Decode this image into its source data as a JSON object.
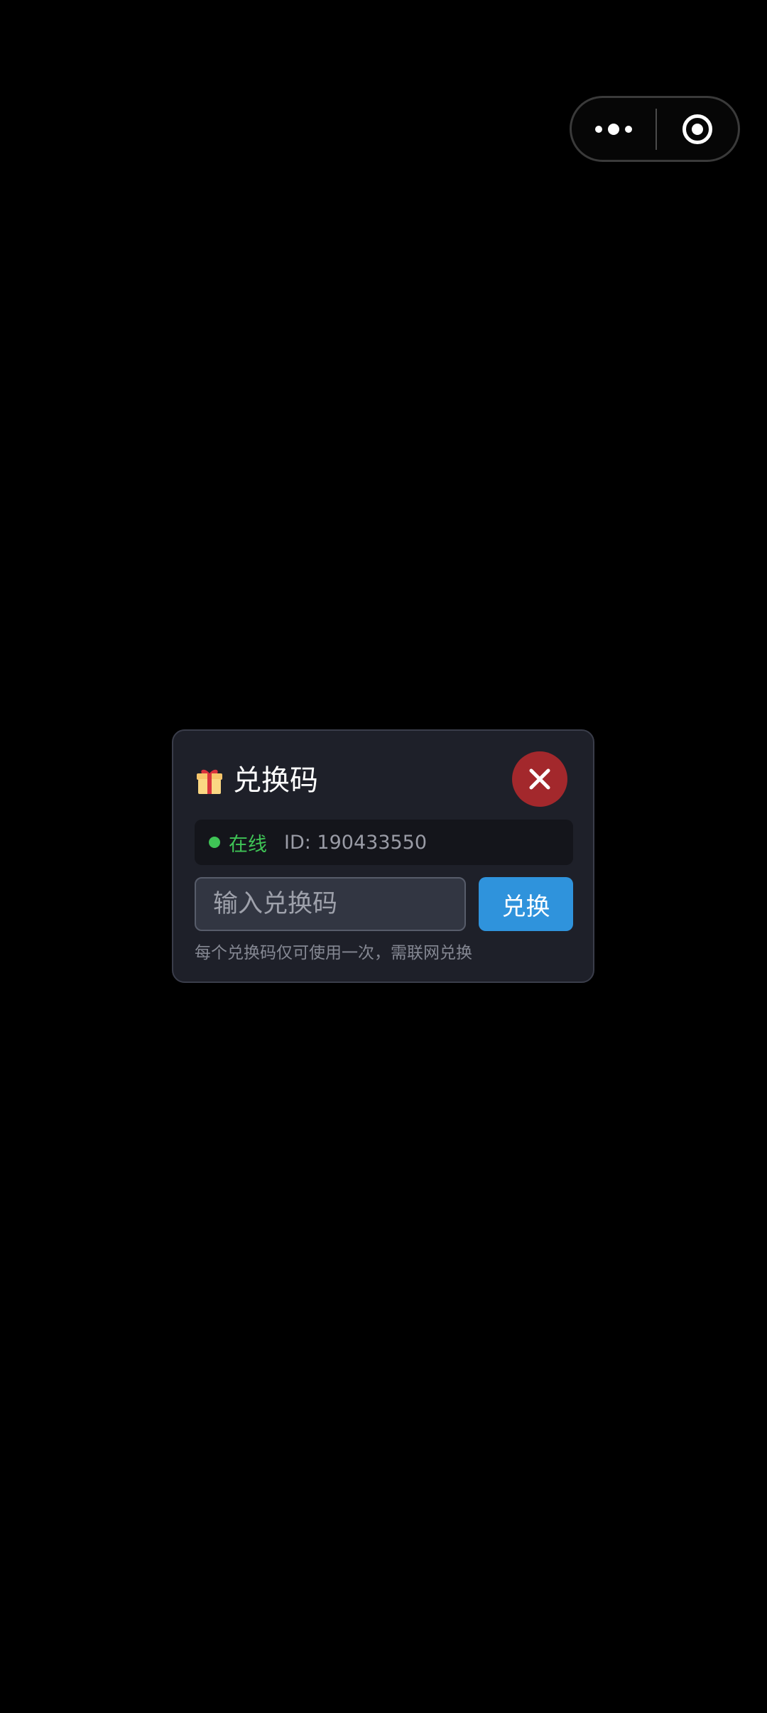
{
  "capsule": {
    "more_icon": "more-dots-icon",
    "close_icon": "target-circle-icon"
  },
  "dialog": {
    "icon": "gift-icon",
    "title": "兑换码",
    "close_icon": "close-icon",
    "status": {
      "label": "在线",
      "id_text": "ID: 190433550",
      "color": "#3fc456"
    },
    "input": {
      "value": "",
      "placeholder": "输入兑换码"
    },
    "redeem_label": "兑换",
    "hint": "每个兑换码仅可使用一次，需联网兑换"
  },
  "colors": {
    "background": "#000000",
    "dialog_bg": "#1e2029",
    "close_button": "#a3282c",
    "redeem_button": "#2f93dc",
    "online_green": "#3fc456"
  }
}
